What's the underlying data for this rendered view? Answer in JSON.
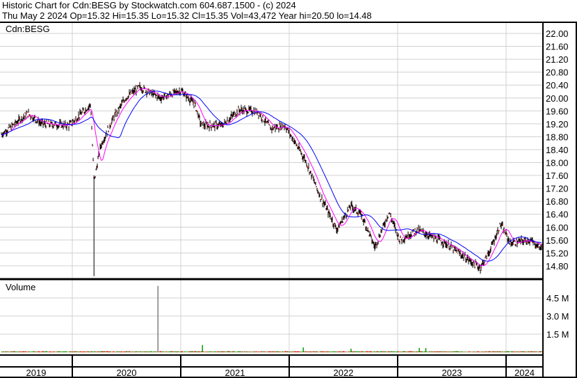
{
  "header": {
    "title": "Historic Chart for Cdn:BESG by Stockwatch.com 604.687.1500 - (c) 2024",
    "quote": "Thu May  2 2024  Op=15.32  Hi=15.35  Lo=15.32  Cl=15.35  Vol=43,472  Year hi=20.50  lo=14.48"
  },
  "chart_data": [
    {
      "type": "line",
      "title": "Cdn:BESG",
      "ylim": [
        14.48,
        22.4
      ],
      "y_ticks": [
        "22.00",
        "21.60",
        "21.20",
        "20.80",
        "20.40",
        "20.00",
        "19.60",
        "19.20",
        "18.80",
        "18.40",
        "18.00",
        "17.60",
        "17.20",
        "16.80",
        "16.40",
        "16.00",
        "15.60",
        "15.20",
        "14.80"
      ],
      "x_ticks": [
        "2019",
        "2020",
        "2021",
        "2022",
        "2023",
        "2024"
      ],
      "xlim": [
        2019.33,
        2024.34
      ],
      "grid": true,
      "series": [
        {
          "name": "Price (OHLC)",
          "color": "#000000",
          "x": [
            2019.33,
            2019.59,
            2019.72,
            2019.97,
            2020.17,
            2020.2,
            2020.26,
            2020.36,
            2020.49,
            2020.62,
            2020.81,
            2021.0,
            2021.13,
            2021.19,
            2021.38,
            2021.54,
            2021.71,
            2021.83,
            2021.96,
            2022.15,
            2022.28,
            2022.44,
            2022.57,
            2022.67,
            2022.79,
            2022.92,
            2023.02,
            2023.18,
            2023.44,
            2023.76,
            2023.85,
            2023.95,
            2024.04,
            2024.21,
            2024.33
          ],
          "y": [
            18.83,
            19.52,
            19.2,
            19.15,
            19.8,
            17.4,
            18.5,
            19.26,
            20.0,
            20.34,
            20.0,
            20.23,
            19.8,
            19.15,
            19.15,
            19.63,
            19.58,
            19.05,
            19.15,
            18.07,
            17.0,
            15.92,
            16.67,
            16.35,
            15.38,
            16.46,
            15.6,
            15.92,
            15.5,
            14.73,
            15.27,
            16.09,
            15.5,
            15.6,
            15.35
          ]
        },
        {
          "name": "Short moving average",
          "color": "#ff00ff"
        },
        {
          "name": "Long moving average",
          "color": "#0000ff"
        }
      ],
      "crash_low": {
        "x": 2020.2,
        "y": 14.48
      }
    },
    {
      "type": "bar",
      "title": "Volume",
      "y_ticks": [
        "4.5 M",
        "3.0 M",
        "1.5 M"
      ],
      "ylim": [
        0,
        6000000
      ],
      "spikes": [
        {
          "x": 2020.79,
          "y": 5500000
        },
        {
          "x": 2021.2,
          "y": 600000
        },
        {
          "x": 2022.13,
          "y": 400000
        },
        {
          "x": 2022.57,
          "y": 300000
        },
        {
          "x": 2023.2,
          "y": 350000
        },
        {
          "x": 2023.26,
          "y": 350000
        }
      ],
      "baseline": 60000
    }
  ]
}
